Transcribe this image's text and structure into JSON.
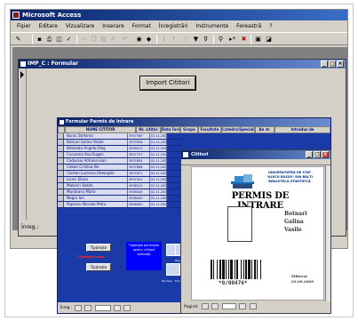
{
  "app": {
    "title": "Microsoft Access",
    "menu": [
      "Fişier",
      "Editare",
      "Vizualizare",
      "Inserare",
      "Format",
      "Înregistrări",
      "Instrumente",
      "Fereastră",
      "?"
    ]
  },
  "import_form": {
    "title": "IMP_C : Formular",
    "import_button": "Import Cititori",
    "record_label": "Înreg.:"
  },
  "readers_form": {
    "title": "Formular Permis de intrare",
    "columns": [
      "NUME CITITOR",
      "Nr. cititor",
      "Data Înreg.",
      "Grupa",
      "Facultate",
      "Catedra/Specializ",
      "An st.",
      "Introdus de"
    ],
    "rows": [
      {
        "name": "Burac Stefania",
        "nr": "3937369",
        "date": "01.11.2004"
      },
      {
        "name": "Botnari Galina Vasile",
        "nr": "3937636",
        "date": "01.11.2007"
      },
      {
        "name": "Botezatu Angela Oleg",
        "nr": "3938013",
        "date": "02.11.2007"
      },
      {
        "name": "Cucuiana Ana Eugen",
        "nr": "3937797",
        "date": "02.11.2007"
      },
      {
        "name": "Caduraiu Adriana Ioan",
        "nr": "3937854",
        "date": "02.11.2007"
      },
      {
        "name": "Ceban Cristina Ilie",
        "nr": "3937868",
        "date": "02.11.2007"
      },
      {
        "name": "Ciortan Lucrecia Gheorghe",
        "nr": "3937871",
        "date": "02.11.2007"
      },
      {
        "name": "Lisnic Elena",
        "nr": "3937941",
        "date": "02.11.2007"
      },
      {
        "name": "Malanin Vadim",
        "nr": "3938011",
        "date": "02.11.2007"
      },
      {
        "name": "Munteanu Maria",
        "nr": "3938040",
        "date": "02.11.2007"
      },
      {
        "name": "Negru Ion",
        "nr": "3938050",
        "date": "02.11.2007"
      },
      {
        "name": "Popescu Nicolae Petru",
        "nr": "3938063",
        "date": "02.11.2007"
      }
    ],
    "btn_one": "Tipăreşte",
    "red_label": "Tipăreşte toate",
    "btn_all": "Tipăreşte",
    "info_box": "Tipăreşte permisele pentru cititorii selectaţi",
    "tile_labels": [
      "Permise",
      "Formulare",
      "Rapoarte"
    ],
    "record_label": "Înreg.:"
  },
  "permit_dialog": {
    "title": "Cititori",
    "university": "UNIVERSITATEA DE STAT \"ALECU RUSSO\" DIN BĂLŢI BIBLIOTECA ŞTIINŢIFICĂ",
    "heading": "PERMIS DE INTRARE",
    "surname": "Botnari",
    "first_name": "Galina",
    "patronymic": "Vasile",
    "barcode_number": "*0/00476*",
    "issued_label": "Eliberat",
    "issued_date": "03.09.2009",
    "page_label": "Pagină:"
  },
  "colors": {
    "titlebar": "#0a246a",
    "window_face": "#d4d0c8",
    "form_background": "#1a3aa8",
    "accent_blue": "#0000ff",
    "warning_red": "#ff2a2a"
  }
}
